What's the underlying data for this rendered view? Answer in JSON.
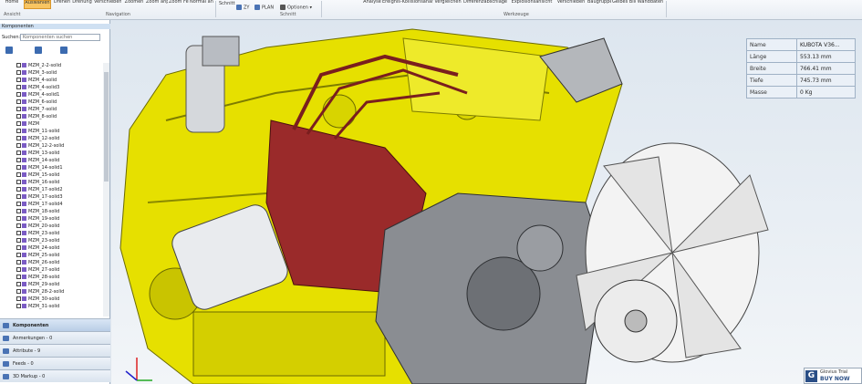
{
  "ribbon": {
    "buttons": [
      "Home",
      "Auswählen",
      "Drehen",
      "Drehung",
      "Verschieben",
      "Zoomen",
      "Zoom anpassen",
      "Zoom Fenster",
      "Normal anzeigen"
    ],
    "group_labels": [
      "Ansicht",
      "Navigation",
      "Schnitt",
      "Werkzeuge"
    ],
    "schnitt_items": [
      "Schnitt",
      "ZY",
      "PLAN",
      "Optionen"
    ],
    "werkzeuge_items": [
      "Analyse",
      "Ereignis-Kollisionsanalyse",
      "Vergleichen",
      "Differenzabschläge",
      "Explosionsansicht",
      "Verschieben",
      "Baugruppe",
      "Gelbes Bild",
      "Wanddaten"
    ]
  },
  "left_panel": {
    "header": "Komponenten",
    "search_label": "Suchen:",
    "search_placeholder": "Komponenten suchen",
    "items": [
      "MZM_2-2-solid",
      "MZM_3-solid",
      "MZM_4-solid",
      "MZM_4-solid3",
      "MZM_4-solid1",
      "MZM_6-solid",
      "MZM_7-solid",
      "MZM_8-solid",
      "MZM",
      "MZM_11-solid",
      "MZM_12-solid",
      "MZM_12-2-solid",
      "MZM_13-solid",
      "MZM_14-solid",
      "MZM_14-solid1",
      "MZM_15-solid",
      "MZM_16-solid",
      "MZM_17-solid2",
      "MZM_17-solid3",
      "MZM_17-solid4",
      "MZM_18-solid",
      "MZM_19-solid",
      "MZM_20-solid",
      "MZM_23-solid",
      "MZM_23-solid",
      "MZM_24-solid",
      "MZM_25-solid",
      "MZM_26-solid",
      "MZM_27-solid",
      "MZM_28-solid",
      "MZM_29-solid",
      "MZM_28-2-solid",
      "MZM_30-solid",
      "MZM_31-solid"
    ],
    "tabs": [
      "Komponenten",
      "Anmerkungen - 0",
      "Attribute - 9",
      "Feeds - 0",
      "3D Markup - 0"
    ]
  },
  "info_table": {
    "rows": [
      {
        "key": "Name",
        "value": "KUBOTA V36..."
      },
      {
        "key": "Länge",
        "value": "553.13 mm"
      },
      {
        "key": "Breite",
        "value": "766.41 mm"
      },
      {
        "key": "Tiefe",
        "value": "745.73 mm"
      },
      {
        "key": "Masse",
        "value": "0 Kg"
      }
    ]
  },
  "trial_badge": {
    "line1": "Glovius Trial",
    "line2": "BUY NOW"
  },
  "colors": {
    "engine_yellow": "#e6e000",
    "pump_red": "#9a2a2a",
    "gray_parts": "#8a8d92",
    "accent": "#f8c562"
  }
}
